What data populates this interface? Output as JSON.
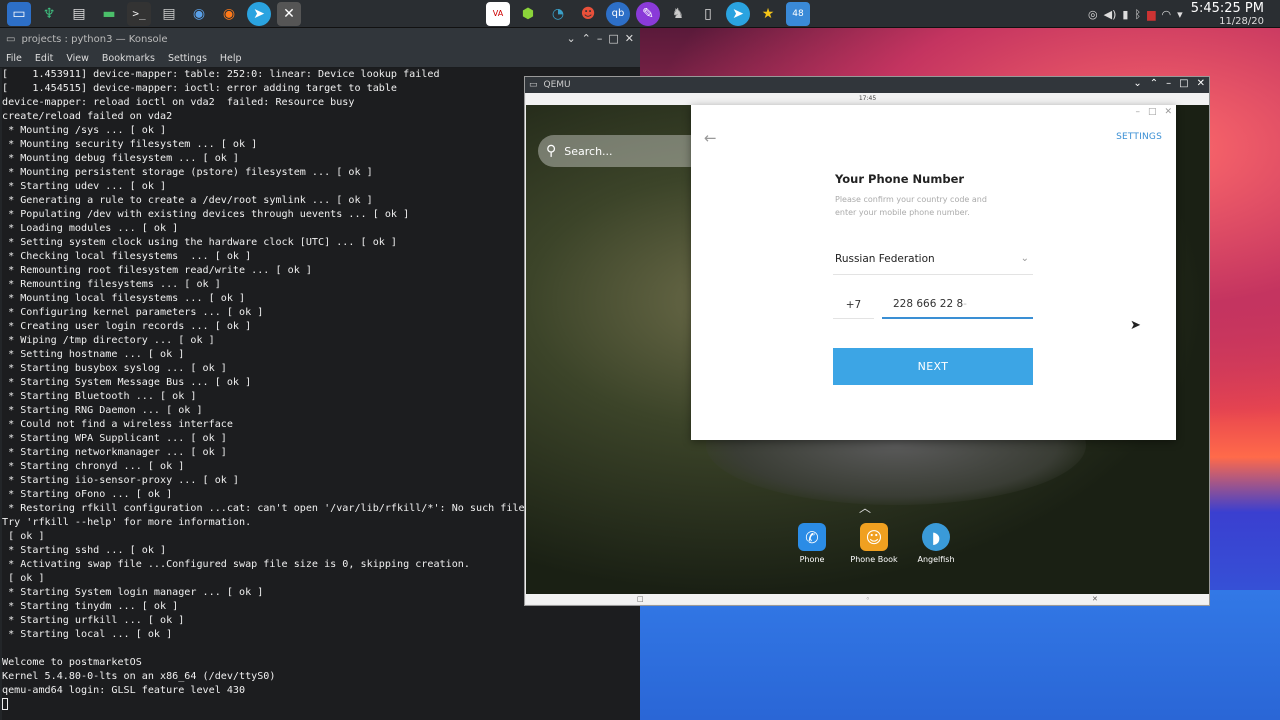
{
  "taskbar": {
    "left_icons": [
      "start-menu-icon",
      "app-manager-icon",
      "store-icon",
      "files-icon",
      "terminal-icon",
      "archive-icon",
      "browser-icon",
      "firefox-icon",
      "telegram-icon",
      "close-icon"
    ],
    "center_icons": [
      "media-icon",
      "cube-icon",
      "speedometer-icon",
      "robot-icon",
      "qbittorrent-icon",
      "color-icon",
      "hat-icon",
      "document-icon",
      "telegram-icon",
      "star-icon",
      "calculator-icon"
    ],
    "clock_time": "5:45:25 PM",
    "clock_date": "11/28/20"
  },
  "konsole": {
    "title": "projects : python3 — Konsole",
    "menu": [
      "File",
      "Edit",
      "View",
      "Bookmarks",
      "Settings",
      "Help"
    ],
    "lines": [
      "[    1.453911] device-mapper: table: 252:0: linear: Device lookup failed",
      "[    1.454515] device-mapper: ioctl: error adding target to table",
      "device-mapper: reload ioctl on vda2  failed: Resource busy",
      "create/reload failed on vda2",
      " * Mounting /sys ... [ ok ]",
      " * Mounting security filesystem ... [ ok ]",
      " * Mounting debug filesystem ... [ ok ]",
      " * Mounting persistent storage (pstore) filesystem ... [ ok ]",
      " * Starting udev ... [ ok ]",
      " * Generating a rule to create a /dev/root symlink ... [ ok ]",
      " * Populating /dev with existing devices through uevents ... [ ok ]",
      " * Loading modules ... [ ok ]",
      " * Setting system clock using the hardware clock [UTC] ... [ ok ]",
      " * Checking local filesystems  ... [ ok ]",
      " * Remounting root filesystem read/write ... [ ok ]",
      " * Remounting filesystems ... [ ok ]",
      " * Mounting local filesystems ... [ ok ]",
      " * Configuring kernel parameters ... [ ok ]",
      " * Creating user login records ... [ ok ]",
      " * Wiping /tmp directory ... [ ok ]",
      " * Setting hostname ... [ ok ]",
      " * Starting busybox syslog ... [ ok ]",
      " * Starting System Message Bus ... [ ok ]",
      " * Starting Bluetooth ... [ ok ]",
      " * Starting RNG Daemon ... [ ok ]",
      " * Could not find a wireless interface",
      " * Starting WPA Supplicant ... [ ok ]",
      " * Starting networkmanager ... [ ok ]",
      " * Starting chronyd ... [ ok ]",
      " * Starting iio-sensor-proxy ... [ ok ]",
      " * Starting oFono ... [ ok ]",
      " * Restoring rfkill configuration ...cat: can't open '/var/lib/rfkill/*': No such file",
      "Try 'rfkill --help' for more information.",
      " [ ok ]",
      " * Starting sshd ... [ ok ]",
      " * Activating swap file ...Configured swap file size is 0, skipping creation.",
      " [ ok ]",
      " * Starting System login manager ... [ ok ]",
      " * Starting tinydm ... [ ok ]",
      " * Starting urfkill ... [ ok ]",
      " * Starting local ... [ ok ]",
      "",
      "Welcome to postmarketOS",
      "Kernel 5.4.80-0-lts on an x86_64 (/dev/ttyS0)",
      "qemu-amd64 login: GLSL feature level 430"
    ]
  },
  "qemu": {
    "title": "QEMU",
    "status_time": "17:45",
    "search_placeholder": "Search...",
    "dialog": {
      "settings": "SETTINGS",
      "title": "Your Phone Number",
      "subtitle": "Please confirm your country code and enter your mobile phone number.",
      "country": "Russian Federation",
      "code": "+7",
      "phone_value": "228 666 22 8",
      "phone_placeholder": "-",
      "next": "NEXT"
    },
    "apps": [
      {
        "label": "Phone",
        "icon": "phone-icon",
        "color": "#2b8ce6"
      },
      {
        "label": "Phone Book",
        "icon": "contacts-icon",
        "color": "#f0a020"
      },
      {
        "label": "Angelfish",
        "icon": "angelfish-icon",
        "color": "#3a9ad8"
      }
    ]
  }
}
